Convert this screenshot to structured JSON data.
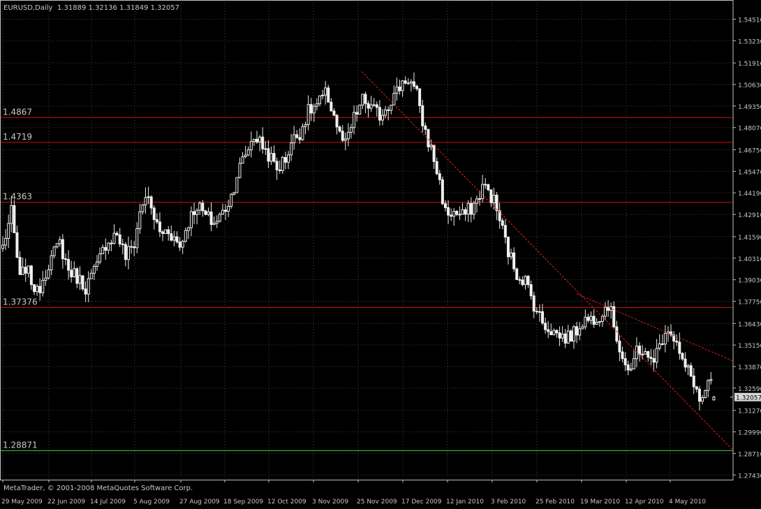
{
  "header": {
    "symbol": "EURUSD,Daily",
    "ohlc": "1.31889 1.32136 1.31849 1.32057"
  },
  "footer": {
    "copyright": "MetaTrader, © 2001-2008 MetaQuotes Software Corp."
  },
  "colors": {
    "background": "#000000",
    "frame": "#c0c0c0",
    "grid": "#3a4a3a",
    "candle": "#f0f0f0",
    "level_line": "#cc1111",
    "level_label": "#c8c8c8",
    "trendline": "#e02020",
    "support_line": "#33cc33",
    "current_price_bg": "#d8d8d8",
    "current_price_text": "#000000"
  },
  "chart_data": {
    "type": "candlestick",
    "symbol": "EURUSD",
    "timeframe": "Daily",
    "last_ohlc": {
      "open": 1.31889,
      "high": 1.32136,
      "low": 1.31849,
      "close": 1.32057
    },
    "current_price": "1.32057",
    "ylim": [
      1.2715,
      1.5565
    ],
    "price_ticks": [
      "1.54510",
      "1.53230",
      "1.51910",
      "1.50630",
      "1.49350",
      "1.48070",
      "1.46750",
      "1.45470",
      "1.44190",
      "1.42910",
      "1.41590",
      "1.40310",
      "1.39030",
      "1.37750",
      "1.36430",
      "1.35150",
      "1.33870",
      "1.32590",
      "1.31270",
      "1.29990",
      "1.28710",
      "1.27430"
    ],
    "date_labels": [
      "29 May 2009",
      "22 Jun 2009",
      "14 Jul 2009",
      "5 Aug 2009",
      "27 Aug 2009",
      "18 Sep 2009",
      "12 Oct 2009",
      "3 Nov 2009",
      "25 Nov 2009",
      "17 Dec 2009",
      "12 Jan 2010",
      "3 Feb 2010",
      "25 Feb 2010",
      "19 Mar 2010",
      "12 Apr 2010",
      "4 May 2010"
    ],
    "horizontal_levels": [
      {
        "label": "1.4867",
        "value": 1.4867,
        "style": "red"
      },
      {
        "label": "1.4719",
        "value": 1.4719,
        "style": "red"
      },
      {
        "label": "1.4363",
        "value": 1.4363,
        "style": "red"
      },
      {
        "label": "1.37376",
        "value": 1.37376,
        "style": "red"
      },
      {
        "label": "1.28871",
        "value": 1.28871,
        "style": "green"
      }
    ],
    "trendlines": [
      {
        "from": {
          "date": "26 Nov 2009",
          "price": 1.514
        },
        "to": {
          "date": "18 May 2010",
          "price": 1.289
        }
      },
      {
        "from": {
          "date": "17 Mar 2010",
          "price": 1.382
        },
        "to": {
          "date": "18 May 2010",
          "price": 1.342
        }
      }
    ],
    "price_path": [
      [
        0,
        1.41
      ],
      [
        3,
        1.43
      ],
      [
        6,
        1.39
      ],
      [
        8,
        1.398
      ],
      [
        12,
        1.382
      ],
      [
        16,
        1.4
      ],
      [
        20,
        1.412
      ],
      [
        23,
        1.396
      ],
      [
        26,
        1.392
      ],
      [
        29,
        1.386
      ],
      [
        33,
        1.398
      ],
      [
        36,
        1.412
      ],
      [
        40,
        1.418
      ],
      [
        43,
        1.404
      ],
      [
        46,
        1.412
      ],
      [
        48,
        1.43
      ],
      [
        50,
        1.441
      ],
      [
        52,
        1.432
      ],
      [
        55,
        1.418
      ],
      [
        58,
        1.42
      ],
      [
        62,
        1.41
      ],
      [
        65,
        1.425
      ],
      [
        68,
        1.435
      ],
      [
        71,
        1.428
      ],
      [
        74,
        1.424
      ],
      [
        77,
        1.43
      ],
      [
        80,
        1.44
      ],
      [
        82,
        1.453
      ],
      [
        85,
        1.465
      ],
      [
        88,
        1.476
      ],
      [
        91,
        1.47
      ],
      [
        94,
        1.462
      ],
      [
        96,
        1.456
      ],
      [
        99,
        1.462
      ],
      [
        101,
        1.472
      ],
      [
        104,
        1.478
      ],
      [
        107,
        1.49
      ],
      [
        110,
        1.494
      ],
      [
        113,
        1.5
      ],
      [
        114,
        1.498
      ],
      [
        116,
        1.488
      ],
      [
        118,
        1.476
      ],
      [
        120,
        1.47
      ],
      [
        123,
        1.486
      ],
      [
        126,
        1.497
      ],
      [
        129,
        1.492
      ],
      [
        132,
        1.488
      ],
      [
        135,
        1.495
      ],
      [
        138,
        1.502
      ],
      [
        140,
        1.508
      ],
      [
        142,
        1.51
      ],
      [
        144,
        1.504
      ],
      [
        145,
        1.5
      ],
      [
        146,
        1.49
      ],
      [
        148,
        1.478
      ],
      [
        151,
        1.462
      ],
      [
        153,
        1.448
      ],
      [
        155,
        1.43
      ],
      [
        158,
        1.43
      ],
      [
        161,
        1.428
      ],
      [
        164,
        1.433
      ],
      [
        166,
        1.437
      ],
      [
        168,
        1.446
      ],
      [
        170,
        1.443
      ],
      [
        172,
        1.437
      ],
      [
        174,
        1.426
      ],
      [
        177,
        1.407
      ],
      [
        180,
        1.394
      ],
      [
        183,
        1.39
      ],
      [
        185,
        1.38
      ],
      [
        187,
        1.372
      ],
      [
        189,
        1.365
      ],
      [
        191,
        1.362
      ],
      [
        194,
        1.358
      ],
      [
        197,
        1.356
      ],
      [
        200,
        1.358
      ],
      [
        203,
        1.366
      ],
      [
        206,
        1.367
      ],
      [
        209,
        1.37
      ],
      [
        212,
        1.376
      ],
      [
        214,
        1.364
      ],
      [
        216,
        1.35
      ],
      [
        218,
        1.34
      ],
      [
        220,
        1.333
      ],
      [
        222,
        1.35
      ],
      [
        224,
        1.348
      ],
      [
        226,
        1.342
      ],
      [
        228,
        1.345
      ],
      [
        230,
        1.35
      ],
      [
        232,
        1.362
      ],
      [
        234,
        1.36
      ],
      [
        236,
        1.352
      ],
      [
        238,
        1.34
      ],
      [
        240,
        1.336
      ],
      [
        242,
        1.33
      ],
      [
        244,
        1.318
      ],
      [
        246,
        1.322
      ],
      [
        248,
        1.33
      ],
      [
        249,
        1.321
      ]
    ]
  }
}
